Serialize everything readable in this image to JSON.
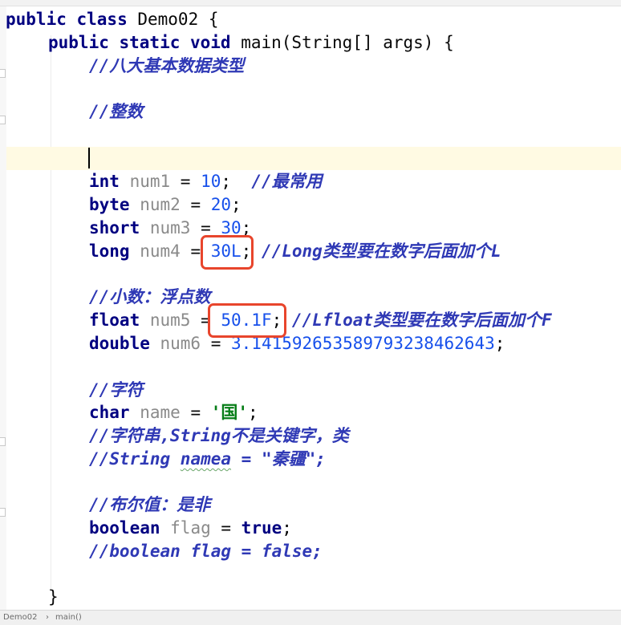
{
  "code": {
    "class_decl": {
      "kw": "public class",
      "name": " Demo02 {"
    },
    "method_decl": {
      "kw": "public static void",
      "rest": " main(String[] args) {"
    },
    "comment_basic_types": "//八大基本数据类型",
    "comment_integer": "//整数",
    "line_int": {
      "type": "int",
      "var": " num1",
      "op": " = ",
      "value": "10",
      "end": ";",
      "comment": "  //最常用"
    },
    "line_byte": {
      "type": "byte",
      "var": " num2",
      "op": " = ",
      "value": "20",
      "end": ";"
    },
    "line_short": {
      "type": "short",
      "var": " num3",
      "op": " = ",
      "value": "30",
      "end": ";"
    },
    "line_long": {
      "type": "long",
      "var": " num4",
      "op": " = ",
      "value": "30L",
      "end": ";",
      "comment": " //Long类型要在数字后面加个L"
    },
    "comment_float_head": "//小数：浮点数",
    "line_float": {
      "type": "float",
      "var": " num5",
      "op": " = ",
      "value": "50.1F",
      "end": ";",
      "comment": " //Lfloat类型要在数字后面加个F"
    },
    "line_double": {
      "type": "double",
      "var": " num6",
      "op": " = ",
      "value": "3.141592653589793238462643",
      "end": ";"
    },
    "comment_char": "//字符",
    "line_char": {
      "type": "char",
      "var": " name",
      "op": " = ",
      "value": "'国'",
      "end": ";"
    },
    "comment_string": "//字符串,String不是关键字，类",
    "comment_string_example": {
      "a": "//String ",
      "b": "namea",
      "c": " = \"秦疆\";"
    },
    "comment_boolean": "//布尔值：是非",
    "line_boolean": {
      "type": "boolean",
      "var": " flag",
      "op": " = ",
      "value": "true",
      "end": ";"
    },
    "comment_boolean_false": "//boolean flag = false;",
    "closing_brace": "}"
  },
  "status_bar": {
    "class_name": "Demo02",
    "separator": "›",
    "method_name": "main()"
  },
  "colors": {
    "keyword": "#000080",
    "number": "#1750eb",
    "comment": "#2f39b5",
    "highlight_box": "#e8452c",
    "current_line": "#fffae3"
  }
}
